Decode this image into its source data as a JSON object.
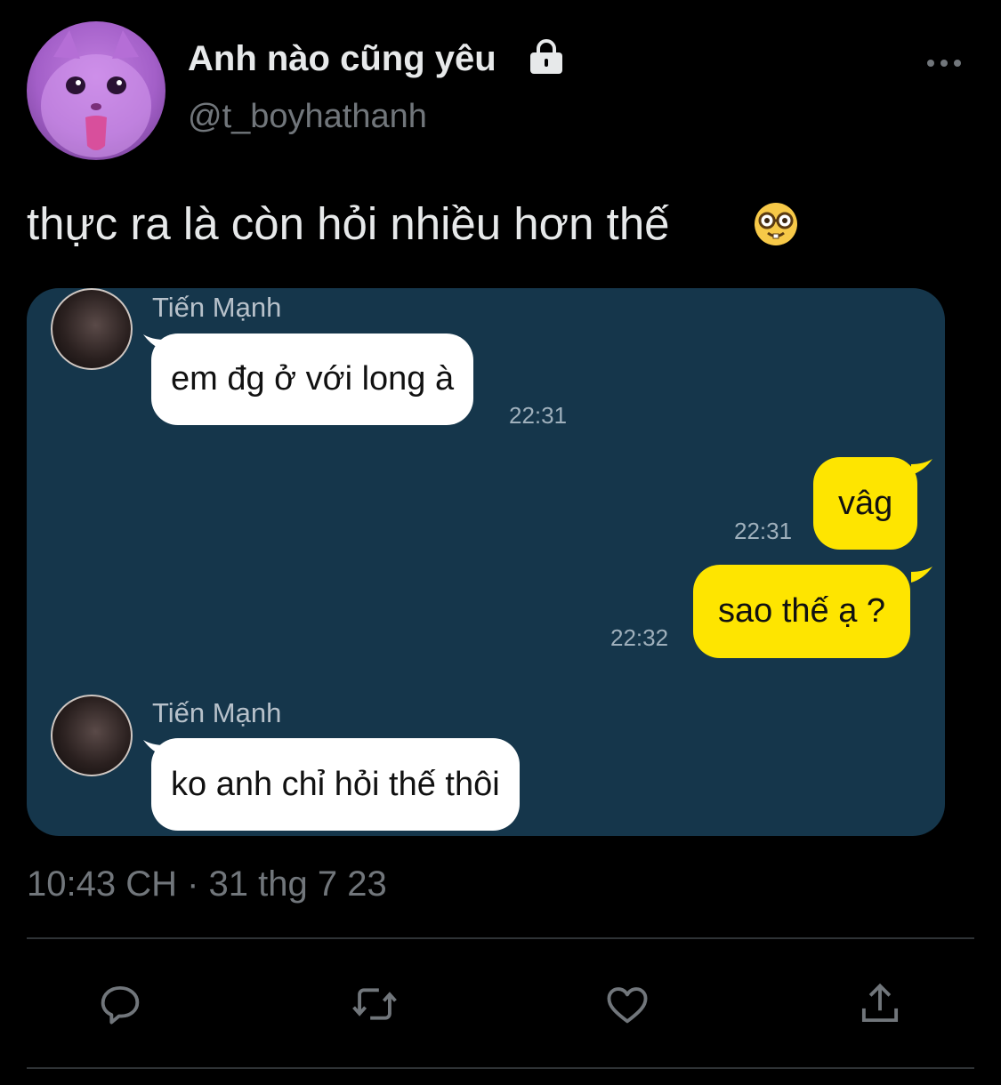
{
  "author": {
    "name": "Anh nào cũng yêu",
    "handle": "@t_boyhathanh",
    "avatar_icon": "cat-avatar",
    "protected_icon": "lock-icon"
  },
  "tweet": {
    "text": "thực ra là còn hỏi nhiều hơn thế",
    "emoji_icon": "nerd-face-emoji",
    "timestamp": "10:43 CH · 31 thg 7 23"
  },
  "chat": {
    "background": "#15364b",
    "incoming_color": "#ffffff",
    "outgoing_color": "#fee500",
    "messages": [
      {
        "direction": "in",
        "sender": "Tiến Mạnh",
        "text": "em đg ở với long à",
        "time": "22:31"
      },
      {
        "direction": "out",
        "text": "vâg",
        "time": "22:31"
      },
      {
        "direction": "out",
        "text": "sao thế ạ ?",
        "time": "22:32"
      },
      {
        "direction": "in",
        "sender": "Tiến Mạnh",
        "text": "ko anh chỉ hỏi thế thôi",
        "time": ""
      }
    ]
  },
  "actions": [
    "reply-icon",
    "retweet-icon",
    "like-icon",
    "share-icon"
  ]
}
